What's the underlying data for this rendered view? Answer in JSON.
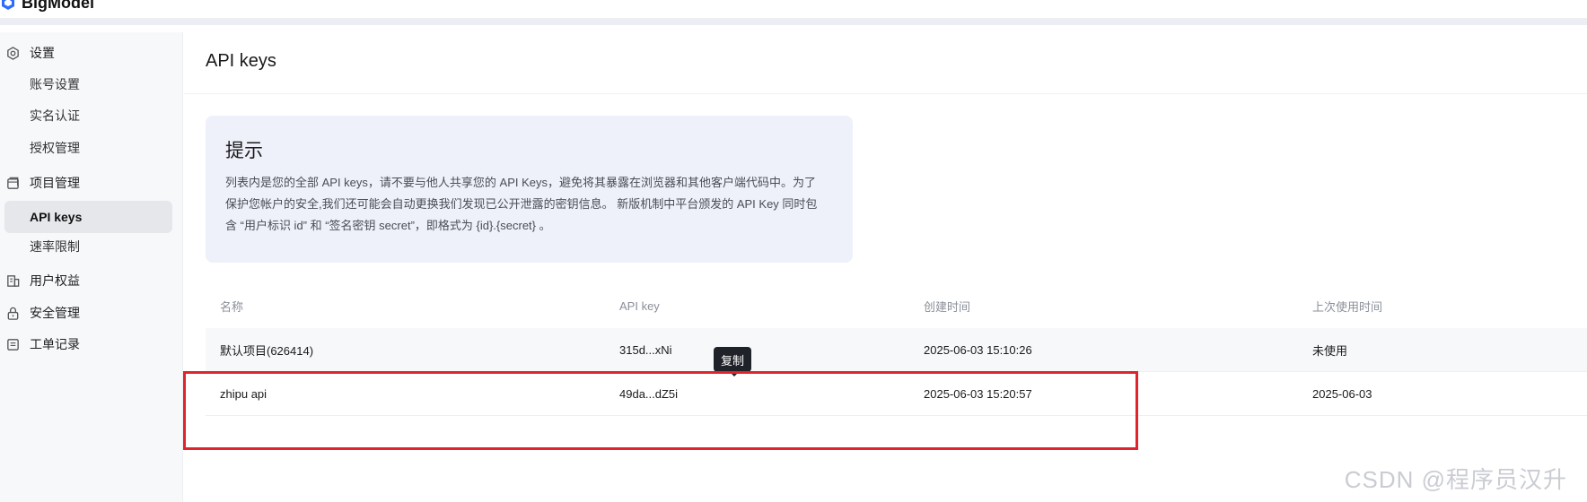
{
  "brand": {
    "name": "BigModel"
  },
  "sidebar": {
    "groups": [
      {
        "label": "设置",
        "icon": "settings-icon"
      },
      {
        "label": "项目管理",
        "icon": "project-icon"
      },
      {
        "label": "用户权益",
        "icon": "rights-icon"
      },
      {
        "label": "安全管理",
        "icon": "lock-icon"
      },
      {
        "label": "工单记录",
        "icon": "ticket-icon"
      }
    ],
    "items": [
      {
        "label": "账号设置"
      },
      {
        "label": "实名认证"
      },
      {
        "label": "授权管理"
      },
      {
        "label": "API keys",
        "active": true
      },
      {
        "label": "速率限制"
      }
    ]
  },
  "main": {
    "title": "API keys",
    "tip": {
      "title": "提示",
      "body": "列表内是您的全部 API keys，请不要与他人共享您的 API Keys，避免将其暴露在浏览器和其他客户端代码中。为了保护您帐户的安全,我们还可能会自动更换我们发现已公开泄露的密钥信息。 新版机制中平台颁发的 API Key 同时包含 “用户标识 id” 和 “签名密钥 secret”，即格式为 {id}.{secret} 。"
    },
    "table": {
      "headers": [
        "名称",
        "API key",
        "创建时间",
        "上次使用时间"
      ],
      "rows": [
        {
          "name": "默认项目(626414)",
          "key": "315d...xNi",
          "created": "2025-06-03 15:10:26",
          "last_used": "未使用"
        },
        {
          "name": "zhipu api",
          "key": "49da...dZ5i",
          "created": "2025-06-03 15:20:57",
          "last_used": "2025-06-03"
        }
      ]
    },
    "tooltip": "复制"
  },
  "watermark": "CSDN @程序员汉升",
  "colors": {
    "highlight": "#e0242c",
    "tip_bg": "#eef1fa",
    "sidebar_active": "#e6e7ea"
  }
}
